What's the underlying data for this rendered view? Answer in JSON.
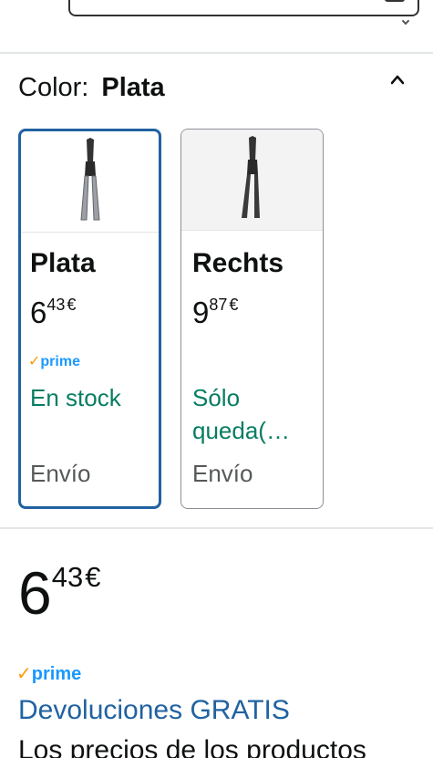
{
  "variant_selector": {
    "label": "Color:",
    "selected_value": "Plata"
  },
  "swatches": [
    {
      "name": "Plata",
      "price_whole": "6",
      "price_fraction": "43",
      "currency": "€",
      "prime": "prime",
      "availability": "En stock",
      "shipping": "Envío",
      "selected": true,
      "handle_color": "#9aa0a6"
    },
    {
      "name": "Rechts",
      "price_whole": "9",
      "price_fraction": "87",
      "currency": "€",
      "availability": "Sólo queda(…",
      "shipping": "Envío",
      "selected": false,
      "handle_color": "#3a3a3a"
    }
  ],
  "buybox": {
    "price_whole": "6",
    "price_fraction": "43",
    "currency": "€",
    "prime": "prime",
    "returns": "Devoluciones GRATIS",
    "disclaimer": "Los precios de los productos"
  },
  "colors": {
    "selected_border": "#2162a1",
    "link": "#2162a1",
    "in_stock": "#067d62",
    "prime_blue": "#1a98ff",
    "prime_check": "#ff9900"
  },
  "icons": {
    "collapse": "chevron-up-icon",
    "product": "tin-snips-icon"
  }
}
